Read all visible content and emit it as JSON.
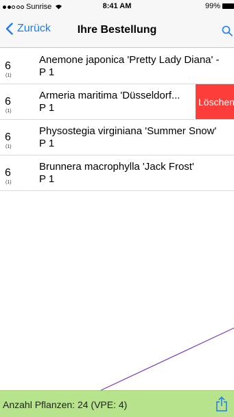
{
  "status": {
    "carrier": "Sunrise",
    "time": "8:41 AM",
    "battery": "99%",
    "signal_bars": 2
  },
  "nav": {
    "back_label": "Zurück",
    "title": "Ihre Bestellung",
    "search_icon": "search-icon",
    "accent_color": "#1a7cf3"
  },
  "items": [
    {
      "qty": "6",
      "sub_qty": "(1)",
      "name": "Anemone japonica 'Pretty Lady Diana' -",
      "pot": "P 1"
    },
    {
      "qty": "6",
      "sub_qty": "(1)",
      "name": "Armeria maritima 'Düsseldorf...",
      "pot": "P 1",
      "delete_label": "Löschen"
    },
    {
      "qty": "6",
      "sub_qty": "(1)",
      "name": "Physostegia virginiana 'Summer Snow'",
      "pot": "P 1"
    },
    {
      "qty": "6",
      "sub_qty": "(1)",
      "name": "Brunnera macrophylla 'Jack Frost'",
      "pot": "P 1"
    }
  ],
  "footer": {
    "count_label": "Anzahl Pflanzen: 24 (VPE: 4)",
    "share_icon": "share-icon",
    "bar_color": "#b7e38c"
  }
}
